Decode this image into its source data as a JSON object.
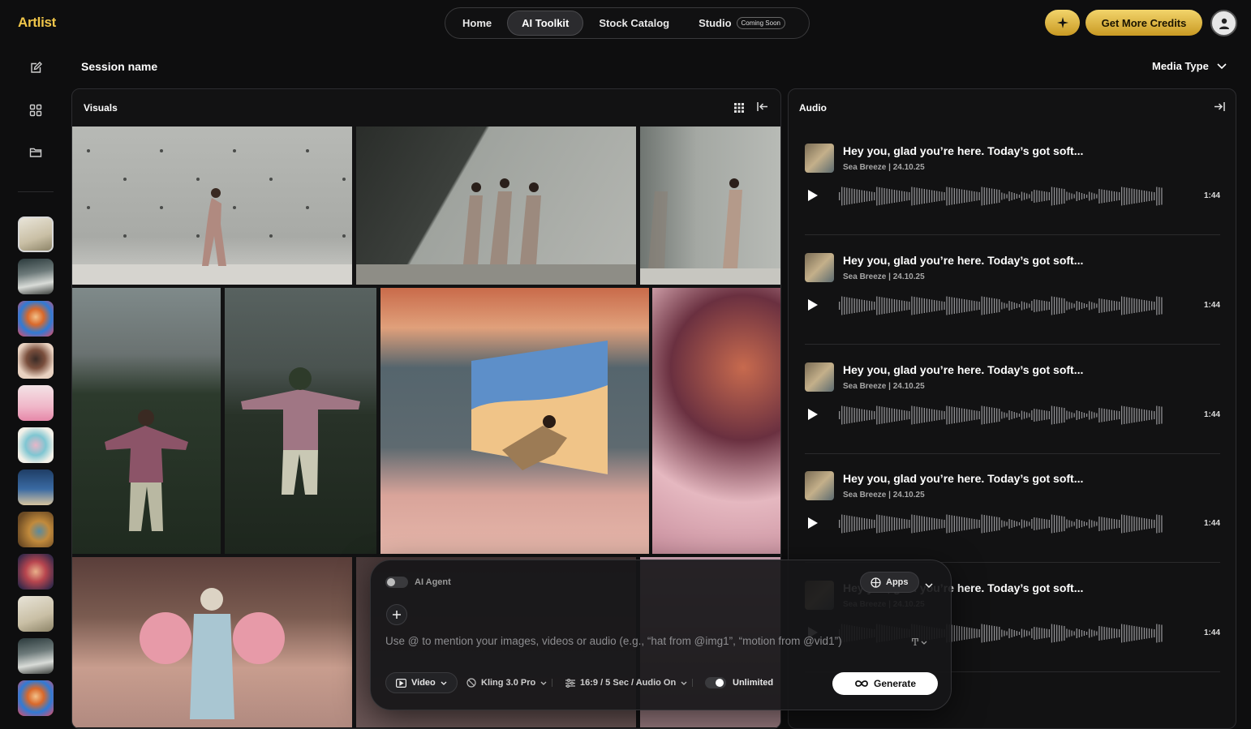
{
  "brand": {
    "logo": "Artlist"
  },
  "topnav": {
    "items": [
      {
        "label": "Home"
      },
      {
        "label": "AI Toolkit"
      },
      {
        "label": "Stock Catalog"
      },
      {
        "label": "Studio",
        "badge": "Coming Soon"
      }
    ]
  },
  "header": {
    "credits_label": "Get More Credits"
  },
  "session": {
    "name": "Session name",
    "media_type_label": "Media Type"
  },
  "visuals": {
    "title": "Visuals"
  },
  "audio": {
    "title": "Audio",
    "tracks": [
      {
        "title": "Hey you, glad you’re here. Today’s got soft...",
        "meta": "Sea Breeze | 24.10.25",
        "duration": "1:44"
      },
      {
        "title": "Hey you, glad you’re here. Today’s got soft...",
        "meta": "Sea Breeze | 24.10.25",
        "duration": "1:44"
      },
      {
        "title": "Hey you, glad you’re here. Today’s got soft...",
        "meta": "Sea Breeze | 24.10.25",
        "duration": "1:44"
      },
      {
        "title": "Hey you, glad you’re here. Today’s got soft...",
        "meta": "Sea Breeze | 24.10.25",
        "duration": "1:44"
      },
      {
        "title": "Hey you, glad you’re here. Today’s got soft...",
        "meta": "Sea Breeze | 24.10.25",
        "duration": "1:44"
      }
    ]
  },
  "composer": {
    "agent_label": "AI Agent",
    "apps_label": "Apps",
    "placeholder": "Use @ to mention your images, videos or audio (e.g., “hat from @img1”, “motion from @vid1”)",
    "video_label": "Video",
    "model_label": "Kling 3.0 Pro",
    "settings_label": "16:9 / 5 Sec / Audio On",
    "unlimited_label": "Unlimited",
    "generate_label": "Generate"
  }
}
